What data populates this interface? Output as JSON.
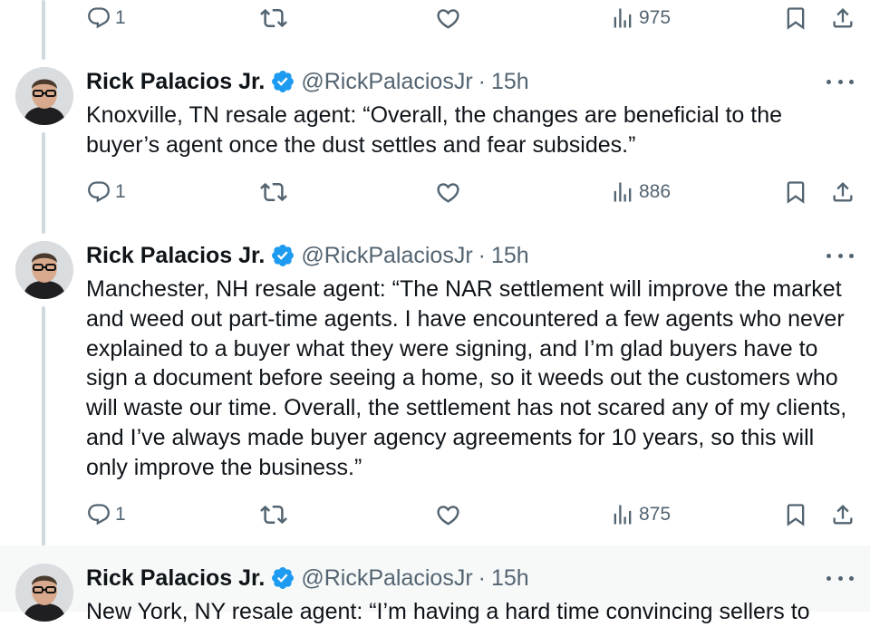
{
  "colors": {
    "text": "#0f1419",
    "secondary": "#536471",
    "verified": "#1d9bf0",
    "thread_line": "#cfd9de",
    "highlight_bg": "#f7f9f9"
  },
  "icons": {
    "reply": "reply-icon",
    "retweet": "retweet-icon",
    "like": "heart-icon",
    "views": "views-icon",
    "bookmark": "bookmark-icon",
    "share": "share-icon",
    "more": "more-icon",
    "verified": "verified-badge-icon"
  },
  "tweets": [
    {
      "display_name": "",
      "handle": "",
      "time": "",
      "text": "",
      "replies": "1",
      "views": "975"
    },
    {
      "display_name": "Rick Palacios Jr.",
      "handle": "@RickPalaciosJr",
      "separator": "·",
      "time": "15h",
      "text": "Knoxville, TN resale agent: “Overall, the changes are beneficial to the buyer’s agent once the dust settles and fear subsides.”",
      "replies": "1",
      "views": "886"
    },
    {
      "display_name": "Rick Palacios Jr.",
      "handle": "@RickPalaciosJr",
      "separator": "·",
      "time": "15h",
      "text": "Manchester, NH resale agent: “The NAR settlement will improve the market and weed out part-time agents. I have encountered a few agents who never explained to a buyer what they were signing, and I’m glad buyers have to sign a document before seeing a home, so it weeds out the customers who will waste our time. Overall, the settlement has not scared any of my clients, and I’ve always made buyer agency agreements for 10 years, so this will only improve the business.”",
      "replies": "1",
      "views": "875"
    },
    {
      "display_name": "Rick Palacios Jr.",
      "handle": "@RickPalaciosJr",
      "separator": "·",
      "time": "15h",
      "text": "New York, NY resale agent: “I’m having a hard time convincing sellers to"
    }
  ]
}
